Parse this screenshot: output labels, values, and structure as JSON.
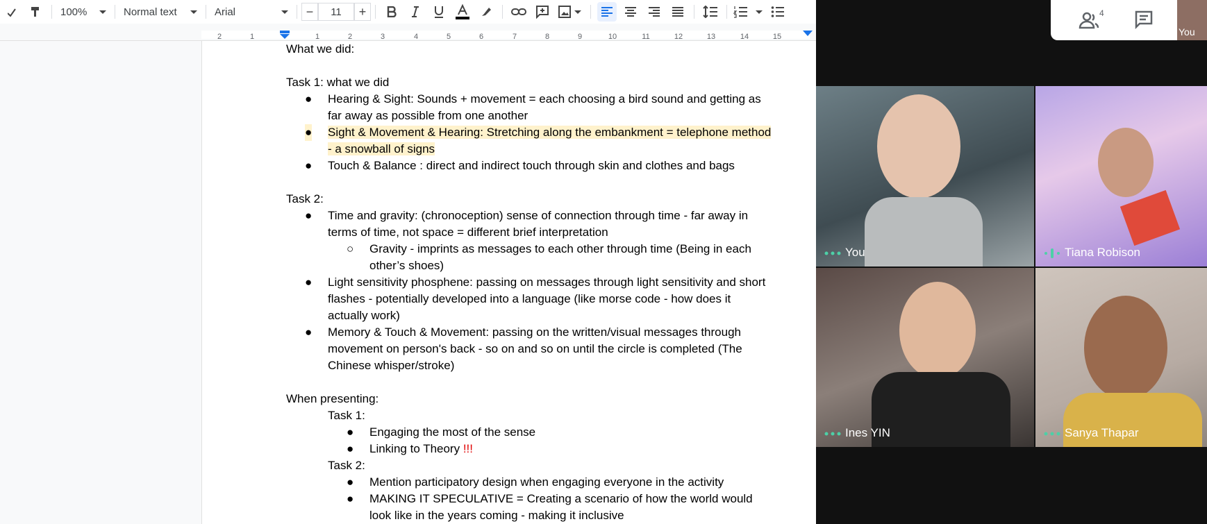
{
  "toolbar": {
    "zoom": "100%",
    "style": "Normal text",
    "font": "Arial",
    "font_size": "11",
    "minus": "−",
    "plus": "+"
  },
  "ruler": [
    "2",
    "1",
    "1",
    "2",
    "3",
    "4",
    "5",
    "6",
    "7",
    "8",
    "9",
    "10",
    "11",
    "12",
    "13",
    "14",
    "15"
  ],
  "document": {
    "l1": "What we did:",
    "l2": "Task 1: what we did",
    "b1a": "Hearing & Sight: Sounds + movement = each choosing a bird sound and getting as",
    "b1b": "far away as possible from one another",
    "b2a": "Sight & Movement & Hearing: Stretching along the embankment = telephone method",
    "b2b": "- a snowball of signs",
    "b3": "Touch & Balance : direct and indirect touch through skin and clothes and bags",
    "l3": "Task 2:",
    "b4a": "Time and gravity: (chronoception) sense of connection through time - far away in",
    "b4b": "terms of time, not space = different brief interpretation",
    "s1a": "Gravity - imprints as messages to each other through time (Being in each",
    "s1b": "other’s shoes)",
    "b5a": "Light sensitivity phosphene: passing on messages through light sensitivity and short",
    "b5b": "flashes - potentially developed into a language (like morse code - how does it",
    "b5c": "actually work)",
    "b6a": "Memory & Touch & Movement: passing on the written/visual messages through",
    "b6b": "movement on person's back - so on and so on until the circle is completed (The",
    "b6c": "Chinese whisper/stroke)",
    "l4": "When presenting:",
    "t1": "Task 1:",
    "p1": "Engaging the most of the sense",
    "p2": "Linking to Theory ",
    "p2_excl": "!!!",
    "t2": "Task 2:",
    "p3": "Mention participatory design when engaging everyone in the activity",
    "p4a": "MAKING IT SPECULATIVE = Creating a scenario of how the world would",
    "p4b": "look like in the years coming - making it inclusive",
    "bullet": "●",
    "circle": "○"
  },
  "meet": {
    "participants_count": "4",
    "self_thumb": "You",
    "tiles": [
      {
        "name": "You"
      },
      {
        "name": "Tiana Robison"
      },
      {
        "name": "Ines YIN"
      },
      {
        "name": "Sanya Thapar"
      }
    ]
  },
  "colors": {
    "highlight": "#fff2cc",
    "accent": "#1a73e8",
    "alert": "#e00000",
    "meet_green": "#4dd0a7"
  }
}
